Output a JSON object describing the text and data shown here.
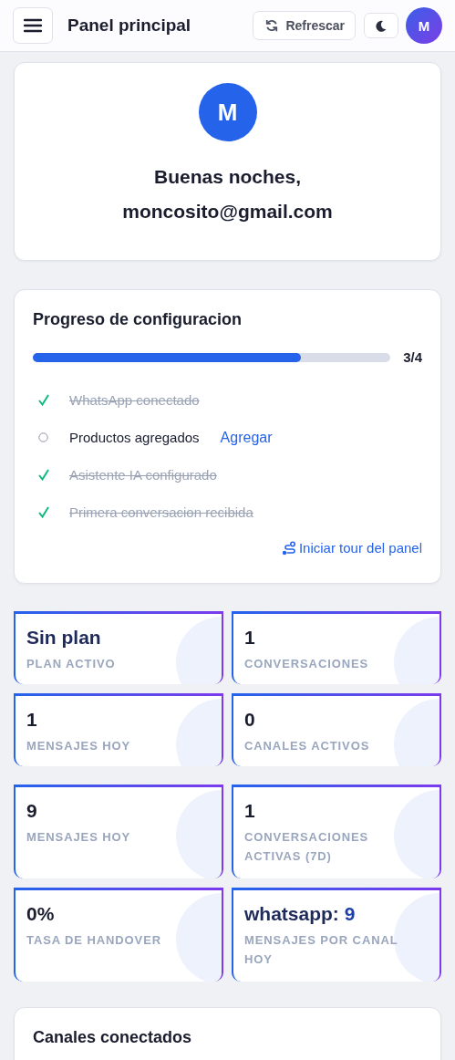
{
  "header": {
    "title": "Panel principal",
    "refresh_label": "Refrescar",
    "avatar_initial": "M"
  },
  "greeting": {
    "avatar_initial": "M",
    "text": "Buenas noches, moncosito@gmail.com"
  },
  "setup": {
    "title": "Progreso de configuracion",
    "level": 0.75,
    "count": "3/4",
    "tour_link": "Iniciar tour del panel",
    "steps": [
      {
        "label": "WhatsApp conectado",
        "done": true
      },
      {
        "label": "Productos agregados",
        "done": false,
        "action": "Agregar"
      },
      {
        "label": "Asistente IA configurado",
        "done": true
      },
      {
        "label": "Primera conversacion recibida",
        "done": true
      }
    ]
  },
  "stat_groups": [
    [
      {
        "value": "Sin plan",
        "label": "PLAN ACTIVO"
      },
      {
        "value": "1",
        "label": "CONVERSACIONES"
      },
      {
        "value": "1",
        "label": "MENSAJES HOY"
      },
      {
        "value": "0",
        "label": "CANALES ACTIVOS"
      }
    ],
    [
      {
        "value": "9",
        "label": "MENSAJES HOY"
      },
      {
        "value": "1",
        "label": "CONVERSACIONES ACTIVAS (7D)"
      },
      {
        "value": "0%",
        "label": "TASA DE HANDOVER"
      },
      {
        "value": "whatsapp:",
        "count": "9",
        "label": "MENSAJES POR CANAL HOY"
      }
    ]
  ],
  "channels": {
    "title": "Canales conectados"
  }
}
